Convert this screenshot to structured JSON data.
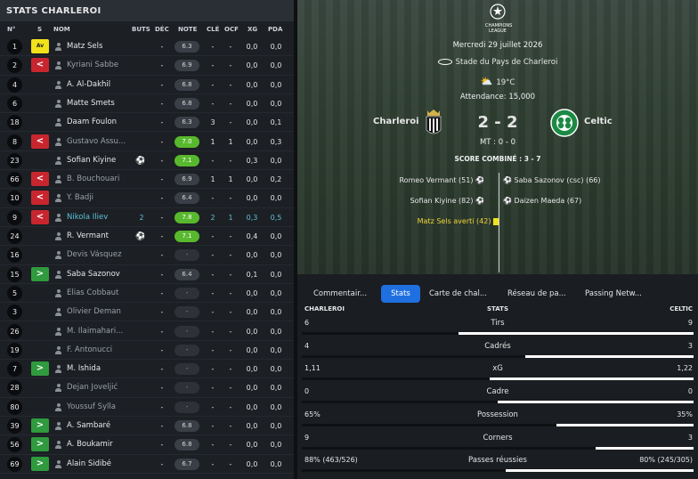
{
  "left": {
    "title": "STATS CHARLEROI",
    "headers": {
      "num": "N°",
      "s": "S",
      "name": "NOM",
      "buts": "BUTS",
      "dec": "DÉC",
      "note": "NOTE",
      "cle": "CLÉ",
      "ocf": "OCF",
      "xg": "XG",
      "pda": "PDA"
    },
    "players": [
      {
        "num": "1",
        "sub": "card",
        "sub_label": "Av",
        "name": "Matz Sels",
        "dim": false,
        "hl": false,
        "ball": false,
        "buts": "",
        "dec": "-",
        "note": "6.3",
        "note_style": "normal",
        "cle": "-",
        "ocf": "-",
        "xg": "0,0",
        "pda": "0,0"
      },
      {
        "num": "2",
        "sub": "out",
        "sub_label": "<",
        "name": "Kyriani Sabbe",
        "dim": true,
        "hl": false,
        "ball": false,
        "buts": "",
        "dec": "-",
        "note": "6.9",
        "note_style": "normal",
        "cle": "-",
        "ocf": "-",
        "xg": "0,0",
        "pda": "0,0"
      },
      {
        "num": "4",
        "sub": "",
        "sub_label": "",
        "name": "A. Al-Dakhil",
        "dim": false,
        "hl": false,
        "ball": false,
        "buts": "",
        "dec": "-",
        "note": "6.8",
        "note_style": "normal",
        "cle": "-",
        "ocf": "-",
        "xg": "0,0",
        "pda": "0,0"
      },
      {
        "num": "6",
        "sub": "",
        "sub_label": "",
        "name": "Matte Smets",
        "dim": false,
        "hl": false,
        "ball": false,
        "buts": "",
        "dec": "-",
        "note": "6.8",
        "note_style": "normal",
        "cle": "-",
        "ocf": "-",
        "xg": "0,0",
        "pda": "0,0"
      },
      {
        "num": "18",
        "sub": "",
        "sub_label": "",
        "name": "Daam Foulon",
        "dim": false,
        "hl": false,
        "ball": false,
        "buts": "",
        "dec": "-",
        "note": "6.3",
        "note_style": "normal",
        "cle": "3",
        "ocf": "-",
        "xg": "0,0",
        "pda": "0,1"
      },
      {
        "num": "8",
        "sub": "out",
        "sub_label": "<",
        "name": "Gustavo Assu...",
        "dim": true,
        "hl": false,
        "ball": false,
        "buts": "",
        "dec": "-",
        "note": "7.0",
        "note_style": "good",
        "cle": "1",
        "ocf": "1",
        "xg": "0,0",
        "pda": "0,3"
      },
      {
        "num": "23",
        "sub": "",
        "sub_label": "",
        "name": "Sofian Kiyine",
        "dim": false,
        "hl": false,
        "ball": true,
        "buts": "",
        "dec": "-",
        "note": "7.1",
        "note_style": "good",
        "cle": "-",
        "ocf": "-",
        "xg": "0,3",
        "pda": "0,0"
      },
      {
        "num": "66",
        "sub": "out",
        "sub_label": "<",
        "name": "B. Bouchouari",
        "dim": true,
        "hl": false,
        "ball": false,
        "buts": "",
        "dec": "-",
        "note": "6.9",
        "note_style": "normal",
        "cle": "1",
        "ocf": "1",
        "xg": "0,0",
        "pda": "0,2"
      },
      {
        "num": "10",
        "sub": "out",
        "sub_label": "<",
        "name": "Y. Badji",
        "dim": true,
        "hl": false,
        "ball": false,
        "buts": "",
        "dec": "-",
        "note": "6.4",
        "note_style": "normal",
        "cle": "-",
        "ocf": "-",
        "xg": "0,0",
        "pda": "0,0"
      },
      {
        "num": "9",
        "sub": "out",
        "sub_label": "<",
        "name": "Nikola Iliev",
        "dim": false,
        "hl": true,
        "ball": false,
        "buts": "2",
        "dec": "-",
        "note": "7.8",
        "note_style": "good",
        "cle": "2",
        "ocf": "1",
        "xg": "0,3",
        "pda": "0,5"
      },
      {
        "num": "24",
        "sub": "",
        "sub_label": "",
        "name": "R. Vermant",
        "dim": false,
        "hl": false,
        "ball": true,
        "buts": "",
        "dec": "-",
        "note": "7.1",
        "note_style": "good",
        "cle": "-",
        "ocf": "-",
        "xg": "0,4",
        "pda": "0,0"
      },
      {
        "num": "16",
        "sub": "",
        "sub_label": "",
        "name": "Devis Vásquez",
        "dim": true,
        "hl": false,
        "ball": false,
        "buts": "",
        "dec": "-",
        "note": "-",
        "note_style": "none",
        "cle": "-",
        "ocf": "-",
        "xg": "0,0",
        "pda": "0,0"
      },
      {
        "num": "15",
        "sub": "in",
        "sub_label": ">",
        "name": "Saba Sazonov",
        "dim": false,
        "hl": false,
        "ball": false,
        "buts": "",
        "dec": "-",
        "note": "6.4",
        "note_style": "normal",
        "cle": "-",
        "ocf": "-",
        "xg": "0,1",
        "pda": "0,0"
      },
      {
        "num": "5",
        "sub": "",
        "sub_label": "",
        "name": "Elias Cobbaut",
        "dim": true,
        "hl": false,
        "ball": false,
        "buts": "",
        "dec": "-",
        "note": "-",
        "note_style": "none",
        "cle": "-",
        "ocf": "-",
        "xg": "0,0",
        "pda": "0,0"
      },
      {
        "num": "3",
        "sub": "",
        "sub_label": "",
        "name": "Olivier Deman",
        "dim": true,
        "hl": false,
        "ball": false,
        "buts": "",
        "dec": "-",
        "note": "-",
        "note_style": "none",
        "cle": "-",
        "ocf": "-",
        "xg": "0,0",
        "pda": "0,0"
      },
      {
        "num": "26",
        "sub": "",
        "sub_label": "",
        "name": "M. Ilaimahari...",
        "dim": true,
        "hl": false,
        "ball": false,
        "buts": "",
        "dec": "-",
        "note": "-",
        "note_style": "none",
        "cle": "-",
        "ocf": "-",
        "xg": "0,0",
        "pda": "0,0"
      },
      {
        "num": "19",
        "sub": "",
        "sub_label": "",
        "name": "F. Antonucci",
        "dim": true,
        "hl": false,
        "ball": false,
        "buts": "",
        "dec": "-",
        "note": "-",
        "note_style": "none",
        "cle": "-",
        "ocf": "-",
        "xg": "0,0",
        "pda": "0,0"
      },
      {
        "num": "7",
        "sub": "in",
        "sub_label": ">",
        "name": "M. Ishida",
        "dim": false,
        "hl": false,
        "ball": false,
        "buts": "",
        "dec": "-",
        "note": "-",
        "note_style": "none",
        "cle": "-",
        "ocf": "-",
        "xg": "0,0",
        "pda": "0,0"
      },
      {
        "num": "28",
        "sub": "",
        "sub_label": "",
        "name": "Dejan Joveljić",
        "dim": true,
        "hl": false,
        "ball": false,
        "buts": "",
        "dec": "-",
        "note": "-",
        "note_style": "none",
        "cle": "-",
        "ocf": "-",
        "xg": "0,0",
        "pda": "0,0"
      },
      {
        "num": "80",
        "sub": "",
        "sub_label": "",
        "name": "Youssuf Sylla",
        "dim": true,
        "hl": false,
        "ball": false,
        "buts": "",
        "dec": "-",
        "note": "-",
        "note_style": "none",
        "cle": "-",
        "ocf": "-",
        "xg": "0,0",
        "pda": "0,0"
      },
      {
        "num": "39",
        "sub": "in",
        "sub_label": ">",
        "name": "A. Sambaré",
        "dim": false,
        "hl": false,
        "ball": false,
        "buts": "",
        "dec": "-",
        "note": "6.8",
        "note_style": "normal",
        "cle": "-",
        "ocf": "-",
        "xg": "0,0",
        "pda": "0,0"
      },
      {
        "num": "56",
        "sub": "in",
        "sub_label": ">",
        "name": "A. Boukamir",
        "dim": false,
        "hl": false,
        "ball": false,
        "buts": "",
        "dec": "-",
        "note": "6.8",
        "note_style": "normal",
        "cle": "-",
        "ocf": "-",
        "xg": "0,0",
        "pda": "0,0"
      },
      {
        "num": "69",
        "sub": "in",
        "sub_label": ">",
        "name": "Alain Sidibé",
        "dim": false,
        "hl": false,
        "ball": false,
        "buts": "",
        "dec": "-",
        "note": "6.7",
        "note_style": "normal",
        "cle": "-",
        "ocf": "-",
        "xg": "0,0",
        "pda": "0,0"
      }
    ]
  },
  "match": {
    "competition_line1": "CHAMPIONS",
    "competition_line2": "LEAGUE",
    "date": "Mercredi 29 juillet 2026",
    "stadium": "Stade du Pays de Charleroi",
    "weather": "19°C",
    "attendance": "Attendance: 15,000",
    "home": "Charleroi",
    "away": "Celtic",
    "score": "2 - 2",
    "halftime": "MT : 0 - 0",
    "combined": "SCORE COMBINÉ : 3 - 7",
    "home_events": [
      "Romeo Vermant (51)",
      "Sofian Kiyine (82)",
      "Matz Sels averti (42)"
    ],
    "away_events": [
      "Saba Sazonov (csc) (66)",
      "Daizen Maeda (67)"
    ]
  },
  "tabs": [
    "Commentair...",
    "Stats",
    "Carte de chal...",
    "Réseau de pa...",
    "Passing Netw..."
  ],
  "active_tab": 1,
  "stats": {
    "home_header": "CHARLEROI",
    "mid_header": "STATS",
    "away_header": "CELTIC",
    "home_color": "#ffffff",
    "away_color": "#ffffff",
    "rows": [
      {
        "label": "Tirs",
        "home": "6",
        "away": "9",
        "home_share": 0.4
      },
      {
        "label": "Cadrés",
        "home": "4",
        "away": "3",
        "home_share": 0.57
      },
      {
        "label": "xG",
        "home": "1,11",
        "away": "1,22",
        "home_share": 0.48
      },
      {
        "label": "Cadre",
        "home": "0",
        "away": "0",
        "home_share": 0.5
      },
      {
        "label": "Possession",
        "home": "65%",
        "away": "35%",
        "home_share": 0.65
      },
      {
        "label": "Corners",
        "home": "9",
        "away": "3",
        "home_share": 0.75
      },
      {
        "label": "Passes réussies",
        "home": "88% (463/526)",
        "away": "80% (245/305)",
        "home_share": 0.52
      }
    ]
  }
}
